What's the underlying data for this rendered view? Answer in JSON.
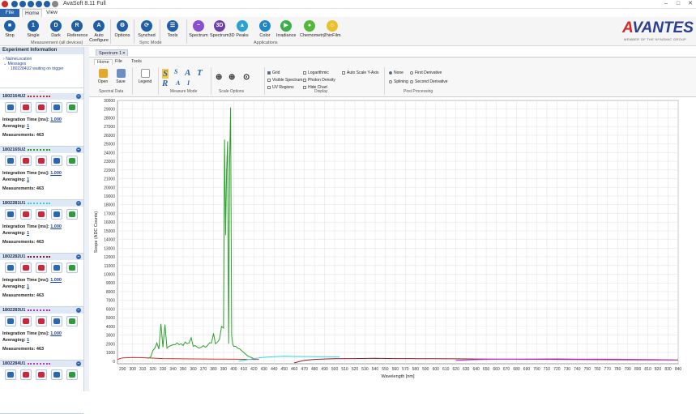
{
  "app": {
    "title": "AvaSoft 8.11 Full",
    "menu": {
      "file": "File",
      "home": "Home",
      "view": "View"
    }
  },
  "ribbon": {
    "buttons": [
      {
        "label": "Stop",
        "icon": "stop-icon"
      },
      {
        "label": "Single",
        "icon": "single-icon"
      },
      {
        "label": "Dark",
        "icon": "dark-icon"
      },
      {
        "label": "Reference",
        "icon": "reference-icon"
      },
      {
        "label": "Auto Configure",
        "icon": "auto-configure-icon"
      },
      {
        "label": "Options",
        "icon": "options-icon"
      },
      {
        "label": "Synched",
        "icon": "synched-icon"
      },
      {
        "label": "Tools",
        "icon": "tools-icon"
      },
      {
        "label": "Spectrum",
        "icon": "spectrum-icon"
      },
      {
        "label": "Spectrum3D",
        "icon": "spectrum3d-icon"
      },
      {
        "label": "Peaks",
        "icon": "peaks-icon"
      },
      {
        "label": "Color",
        "icon": "color-icon"
      },
      {
        "label": "Irradiance",
        "icon": "irradiance-icon"
      },
      {
        "label": "Chemometry",
        "icon": "chemometry-icon"
      },
      {
        "label": "ThinFilm",
        "icon": "thinfilm-icon"
      }
    ],
    "groups": {
      "measurement": "Measurement (all devices)",
      "sync": "Sync Mode",
      "applications": "Applications"
    }
  },
  "logo": {
    "brand_a": "A",
    "brand_rest": "VANTES",
    "tagline": "MEMBER OF THE NYNOMIC GROUP"
  },
  "left_panel": {
    "header": "Experiment Information",
    "tree": {
      "root": "NameLocation",
      "messages": "Messages",
      "message1": "1802284U2 waiting on trigger"
    },
    "grip": "......",
    "labels": {
      "integration": "Integration Time [ms]:",
      "averaging": "Averaging:",
      "measurements": "Measurements:"
    },
    "spectrometers": [
      {
        "id": "1802164U2",
        "color": "#d62a2a",
        "integration": "1.000",
        "averaging": "1",
        "measurements": "463"
      },
      {
        "id": "1802165U2",
        "color": "#2ca02c",
        "integration": "1.000",
        "averaging": "1",
        "measurements": "463"
      },
      {
        "id": "1802281U1",
        "color": "#27d8e6",
        "integration": "1.000",
        "averaging": "1",
        "measurements": "463"
      },
      {
        "id": "1802282U1",
        "color": "#8b1a2c",
        "integration": "1.000",
        "averaging": "1",
        "measurements": "463"
      },
      {
        "id": "1802283U1",
        "color": "#b52bd8",
        "integration": "1.000",
        "averaging": "1",
        "measurements": "463"
      },
      {
        "id": "1802284U1",
        "color": "#c23cc9"
      }
    ]
  },
  "doc_tab": {
    "label": "Spectrum 1",
    "close": "✕"
  },
  "chart_ribbon": {
    "tabs": [
      "Home",
      "File",
      "Tools"
    ],
    "buttons": {
      "open": "Open",
      "save": "Save",
      "legend": "Legend"
    },
    "measure_mode_letters": [
      "S",
      "S",
      "A",
      "T",
      "R",
      "A",
      "I"
    ],
    "groups": {
      "spectral": "Spectral Data",
      "measure": "Measure Mode",
      "scale": "Scale Options",
      "display": "Display",
      "post": "Post Processing"
    },
    "display_options": [
      {
        "label": "Grid",
        "checked": true
      },
      {
        "label": "Visible Spectrum",
        "checked": false
      },
      {
        "label": "UV Regions",
        "checked": false
      },
      {
        "label": "Logarithmic",
        "checked": false
      },
      {
        "label": "Photon Density",
        "checked": false
      },
      {
        "label": "Hide Chart",
        "checked": false
      },
      {
        "label": "Auto Scale Y-Axis",
        "checked": false
      }
    ],
    "post_processing": [
      {
        "label": "None",
        "selected": true
      },
      {
        "label": "First Derivative",
        "selected": false
      },
      {
        "label": "Splining",
        "selected": false
      },
      {
        "label": "Second Derivative",
        "selected": false
      }
    ]
  },
  "chart_data": {
    "type": "line",
    "xlabel": "Wavelength [nm]",
    "ylabel": "Scope (ADC Counts)",
    "xlim": [
      285,
      840
    ],
    "ylim": [
      -300,
      30000
    ],
    "xticks": [
      290,
      300,
      310,
      320,
      330,
      340,
      350,
      360,
      370,
      380,
      390,
      400,
      410,
      420,
      430,
      440,
      450,
      460,
      470,
      480,
      490,
      500,
      510,
      520,
      530,
      540,
      550,
      560,
      570,
      580,
      590,
      600,
      610,
      620,
      630,
      640,
      650,
      660,
      670,
      680,
      690,
      700,
      710,
      720,
      730,
      740,
      750,
      760,
      770,
      780,
      790,
      800,
      810,
      820,
      830,
      840
    ],
    "xtick_labels": [
      "290",
      "300",
      "310",
      "320",
      "330",
      "340",
      "350",
      "360",
      "370",
      "380",
      "390",
      "400",
      "410",
      "420",
      "430",
      "440",
      "450",
      "460",
      "470",
      "480",
      "490",
      "500",
      "510",
      "520",
      "530",
      "540",
      "550",
      "560",
      "570",
      "580",
      "590",
      "600",
      "610",
      "620",
      "630",
      "640",
      "650",
      "660",
      "670",
      "680",
      "690",
      "700",
      "710",
      "720",
      "730",
      "740",
      "750",
      "760",
      "770",
      "780",
      "790",
      "800",
      "810",
      "820",
      "830",
      "840"
    ],
    "yticks": [
      0,
      1000,
      2000,
      3000,
      4000,
      5000,
      6000,
      7000,
      8000,
      9000,
      10000,
      11000,
      12000,
      13000,
      14000,
      15000,
      16000,
      17000,
      18000,
      19000,
      20000,
      21000,
      22000,
      23000,
      24000,
      25000,
      26000,
      27000,
      28000,
      29000,
      30000
    ],
    "grid": true,
    "series": [
      {
        "color": "#d62a2a",
        "x": [
          285,
          290,
          300,
          310,
          320,
          330,
          340,
          350,
          360,
          370,
          380,
          390,
          400,
          410,
          420,
          425
        ],
        "y": [
          200,
          380,
          420,
          400,
          350,
          300,
          280,
          270,
          260,
          250,
          240,
          230,
          220,
          210,
          200,
          200
        ]
      },
      {
        "color": "#2ca02c",
        "x": [
          315,
          318,
          320,
          322,
          324,
          326,
          328,
          330,
          332,
          334,
          336,
          338,
          340,
          342,
          344,
          346,
          348,
          350,
          352,
          354,
          356,
          358,
          360,
          362,
          364,
          366,
          368,
          370,
          372,
          374,
          376,
          378,
          380,
          382,
          384,
          386,
          388,
          390,
          391,
          392,
          393,
          394,
          395,
          396,
          397,
          398,
          399,
          400,
          402,
          404,
          406,
          408,
          410,
          412,
          414,
          416,
          418,
          420
        ],
        "y": [
          300,
          500,
          1200,
          1500,
          2100,
          1400,
          4300,
          1600,
          4200,
          1500,
          1700,
          1800,
          1900,
          1900,
          2100,
          1900,
          2000,
          1800,
          2200,
          2000,
          2100,
          2700,
          1700,
          1800,
          1600,
          1500,
          1600,
          1800,
          1600,
          1800,
          2100,
          2100,
          3200,
          2000,
          2200,
          2500,
          4000,
          3800,
          25500,
          14500,
          22000,
          25300,
          2000,
          23000,
          29200,
          3000,
          2000,
          1700,
          1700,
          1500,
          1400,
          1200,
          1000,
          800,
          600,
          500,
          400,
          300
        ]
      },
      {
        "color": "#27d8e6",
        "x": [
          405,
          410,
          415,
          420,
          430,
          440,
          450,
          460,
          470,
          480,
          490,
          500,
          505
        ],
        "y": [
          0,
          100,
          200,
          300,
          450,
          520,
          560,
          540,
          530,
          520,
          510,
          500,
          500
        ]
      },
      {
        "color": "#8b1a2c",
        "x": [
          460,
          470,
          480,
          490,
          500,
          520,
          540,
          560,
          580,
          600,
          620,
          640,
          660,
          680,
          700,
          720,
          740,
          760,
          780,
          800,
          820,
          840
        ],
        "y": [
          -200,
          100,
          200,
          250,
          280,
          300,
          320,
          300,
          290,
          280,
          270,
          250,
          230,
          220,
          210,
          200,
          190,
          180,
          170,
          160,
          150,
          140
        ]
      },
      {
        "color": "#b52bd8",
        "x": [
          620,
          640,
          660,
          680,
          700,
          720,
          740,
          760,
          780,
          800,
          820,
          835
        ],
        "y": [
          100,
          180,
          220,
          240,
          250,
          260,
          240,
          230,
          220,
          200,
          180,
          150
        ]
      }
    ]
  }
}
